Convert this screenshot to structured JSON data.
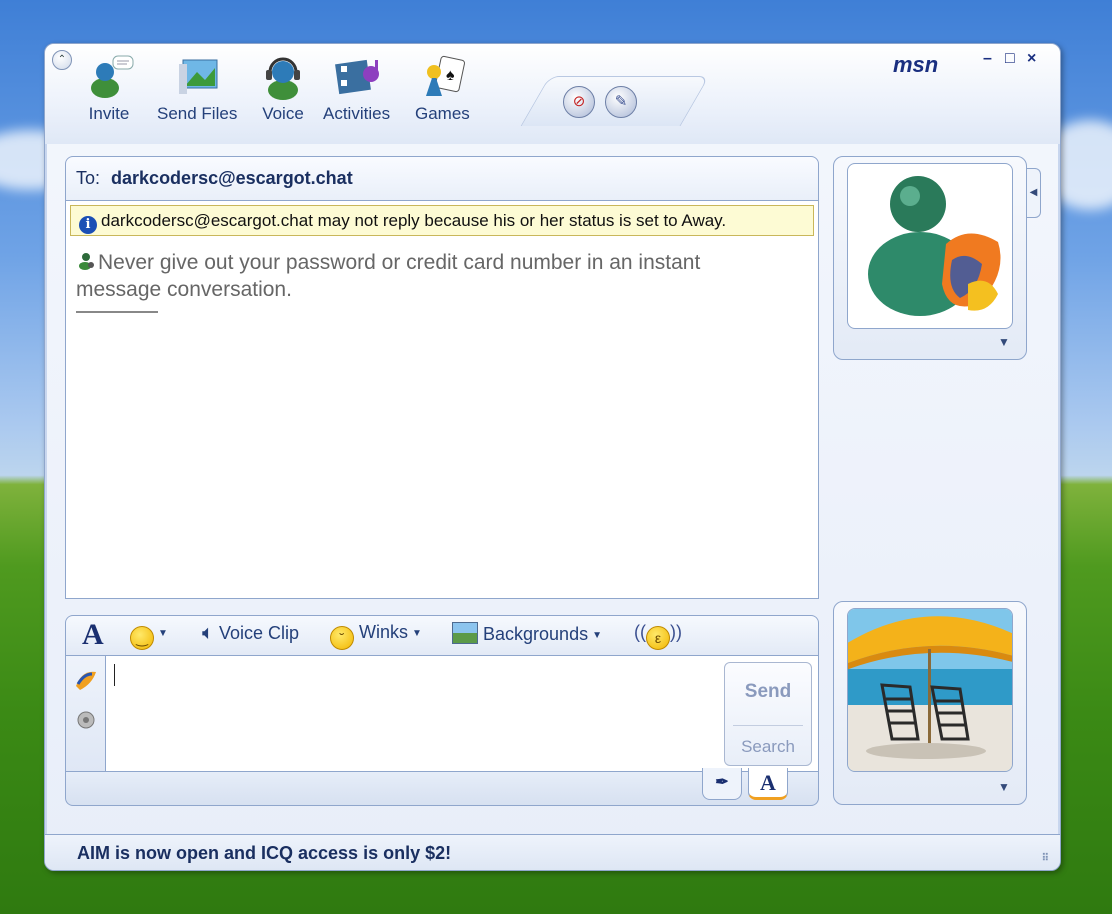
{
  "window": {
    "brand": "msn",
    "controls": [
      "–",
      "□",
      "×"
    ]
  },
  "toolbar": {
    "items": [
      {
        "label": "Invite",
        "icon": "invite-icon"
      },
      {
        "label": "Send Files",
        "icon": "send-files-icon"
      },
      {
        "label": "Voice",
        "icon": "voice-icon"
      },
      {
        "label": "Activities",
        "icon": "activities-icon"
      },
      {
        "label": "Games",
        "icon": "games-icon"
      }
    ],
    "block_icon": "block-icon",
    "draw_icon": "draw-icon"
  },
  "conversation": {
    "to_label": "To:",
    "to_address": "darkcodersc@escargot.chat",
    "notice": "darkcodersc@escargot.chat may not reply because his or her status is set to Away.",
    "warning": "Never give out your password or credit card number in an instant message conversation."
  },
  "compose": {
    "voice_clip": "Voice Clip",
    "winks": "Winks",
    "backgrounds": "Backgrounds",
    "send": "Send",
    "search": "Search"
  },
  "status_bar": {
    "text": "AIM is now open and ICQ access is only $2!"
  },
  "colors": {
    "accent": "#1a2f80",
    "notice_bg": "#fdfbd4",
    "border": "#8fa6cc"
  }
}
